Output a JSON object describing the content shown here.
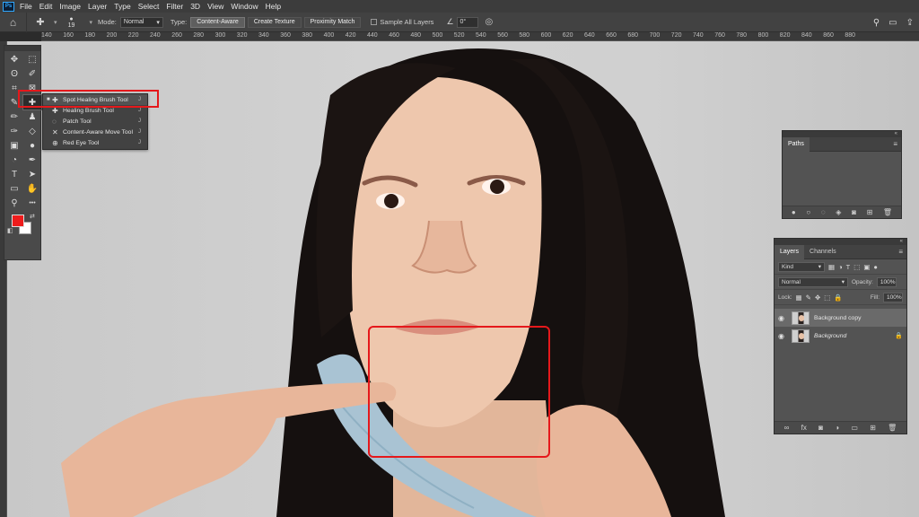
{
  "menubar": {
    "logo": "Ps",
    "items": [
      "File",
      "Edit",
      "Image",
      "Layer",
      "Type",
      "Select",
      "Filter",
      "3D",
      "View",
      "Window",
      "Help"
    ]
  },
  "options": {
    "brush_size": "19",
    "mode_label": "Mode:",
    "mode_value": "Normal",
    "type_label": "Type:",
    "type_buttons": [
      "Content-Aware",
      "Create Texture",
      "Proximity Match"
    ],
    "sample_all_layers": "Sample All Layers",
    "angle_value": "0°"
  },
  "ruler": {
    "ticks": [
      "140",
      "160",
      "180",
      "200",
      "220",
      "240",
      "260",
      "280",
      "300",
      "320",
      "340",
      "360",
      "380",
      "400",
      "420",
      "440",
      "460",
      "480",
      "500",
      "520",
      "540",
      "560",
      "580",
      "600",
      "620",
      "640",
      "660",
      "680",
      "700",
      "720",
      "740",
      "760",
      "780",
      "800",
      "820",
      "840",
      "860",
      "880"
    ]
  },
  "toolbar": {
    "tools": [
      {
        "name": "move-tool-icon",
        "glyph": "✥",
        "active": false
      },
      {
        "name": "marquee-tool-icon",
        "glyph": "⬚",
        "active": false
      },
      {
        "name": "lasso-tool-icon",
        "glyph": "ʘ",
        "active": false
      },
      {
        "name": "quick-selection-tool-icon",
        "glyph": "✐",
        "active": false
      },
      {
        "name": "crop-tool-icon",
        "glyph": "⌗",
        "active": false
      },
      {
        "name": "frame-tool-icon",
        "glyph": "⊠",
        "active": false
      },
      {
        "name": "eyedropper-tool-icon",
        "glyph": "✎",
        "active": false
      },
      {
        "name": "spot-healing-brush-icon",
        "glyph": "✚",
        "active": true
      },
      {
        "name": "brush-tool-icon",
        "glyph": "✏",
        "active": false
      },
      {
        "name": "clone-stamp-tool-icon",
        "glyph": "♟",
        "active": false
      },
      {
        "name": "history-brush-tool-icon",
        "glyph": "✑",
        "active": false
      },
      {
        "name": "eraser-tool-icon",
        "glyph": "◇",
        "active": false
      },
      {
        "name": "gradient-tool-icon",
        "glyph": "▣",
        "active": false
      },
      {
        "name": "blur-tool-icon",
        "glyph": "●",
        "active": false
      },
      {
        "name": "dodge-tool-icon",
        "glyph": "◔",
        "active": false
      },
      {
        "name": "pen-tool-icon",
        "glyph": "✒",
        "active": false
      },
      {
        "name": "type-tool-icon",
        "glyph": "T",
        "active": false
      },
      {
        "name": "path-selection-tool-icon",
        "glyph": "➤",
        "active": false
      },
      {
        "name": "shape-tool-icon",
        "glyph": "▭",
        "active": false
      },
      {
        "name": "hand-tool-icon",
        "glyph": "✋",
        "active": false
      },
      {
        "name": "zoom-tool-icon",
        "glyph": "⚲",
        "active": false
      },
      {
        "name": "more-tools-icon",
        "glyph": "•••",
        "active": false
      }
    ],
    "foreground_color": "#ee1c1c",
    "background_color": "#ffffff"
  },
  "flyout": {
    "items": [
      {
        "label": "Spot Healing Brush Tool",
        "key": "J",
        "icon": "spot-healing-brush-icon",
        "glyph": "✚",
        "selected": true
      },
      {
        "label": "Healing Brush Tool",
        "key": "J",
        "icon": "healing-brush-icon",
        "glyph": "✚",
        "selected": false
      },
      {
        "label": "Patch Tool",
        "key": "J",
        "icon": "patch-tool-icon",
        "glyph": "◌",
        "selected": false
      },
      {
        "label": "Content-Aware Move Tool",
        "key": "J",
        "icon": "content-aware-move-icon",
        "glyph": "✕",
        "selected": false
      },
      {
        "label": "Red Eye Tool",
        "key": "J",
        "icon": "red-eye-icon",
        "glyph": "⊕",
        "selected": false
      }
    ]
  },
  "paths_panel": {
    "tab": "Paths"
  },
  "layers_panel": {
    "tabs": [
      "Layers",
      "Channels"
    ],
    "filter_kind": "Kind",
    "blend_mode": "Normal",
    "opacity_label": "Opacity:",
    "opacity_value": "100%",
    "lock_label": "Lock:",
    "fill_label": "Fill:",
    "fill_value": "100%",
    "layers": [
      {
        "name": "Background copy",
        "selected": true,
        "locked": false
      },
      {
        "name": "Background",
        "selected": false,
        "locked": true
      }
    ]
  },
  "colors": {
    "highlight": "#e5181b",
    "app_bg": "#2b2b2b",
    "panel_bg": "#535353"
  }
}
